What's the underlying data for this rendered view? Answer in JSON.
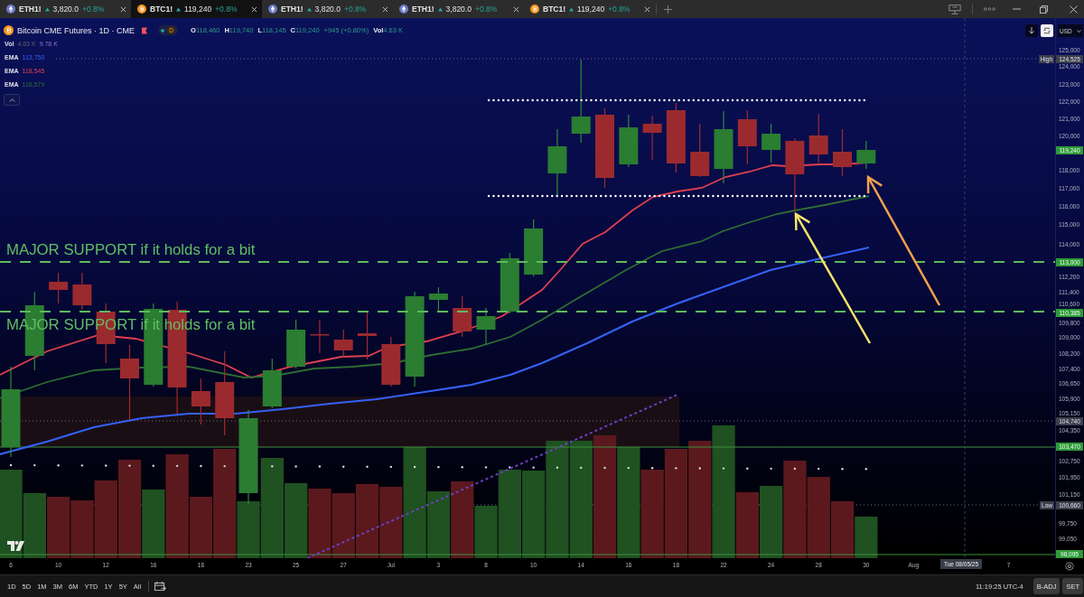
{
  "tabs": [
    {
      "kind": "ethereum",
      "symbol": "ETH1!",
      "price": "3,820.0",
      "change": "+0.8%",
      "selected": false
    },
    {
      "kind": "bitcoin",
      "symbol": "BTC1!",
      "price": "119,240",
      "change": "+0.8%",
      "selected": true
    },
    {
      "kind": "ethereum",
      "symbol": "ETH1!",
      "price": "3,820.0",
      "change": "+0.8%",
      "selected": false
    },
    {
      "kind": "ethereum",
      "symbol": "ETH1!",
      "price": "3,820.0",
      "change": "+0.8%",
      "selected": false
    },
    {
      "kind": "bitcoin",
      "symbol": "BTC1!",
      "price": "119,240",
      "change": "+0.8%",
      "selected": false
    }
  ],
  "legend": {
    "title": "Bitcoin CME Futures · 1D · CME",
    "delay": "D",
    "ohlc": [
      {
        "label": "O",
        "value": "118,460"
      },
      {
        "label": "H",
        "value": "119,740"
      },
      {
        "label": "L",
        "value": "118,145"
      },
      {
        "label": "C",
        "value": "119,240"
      }
    ],
    "change": "+945 (+0.80%)",
    "volume_label": "Vol",
    "volume": "4.63 K"
  },
  "indicators": [
    {
      "name": "Vol",
      "values": [
        "4.63 K",
        "9.78 K"
      ]
    },
    {
      "name": "EMA",
      "values": [
        "113,750"
      ],
      "color": "#3461f5"
    },
    {
      "name": "EMA",
      "values": [
        "118,545"
      ],
      "color": "#e0404f"
    },
    {
      "name": "EMA",
      "values": [
        "116,579"
      ],
      "color": "#2e6d33"
    }
  ],
  "annotations": [
    {
      "text": "MAJOR SUPPORT if it holds for a bit"
    },
    {
      "text": "MAJOR SUPPORT if it holds for a bit"
    }
  ],
  "currency": "USD",
  "price_axis": [
    {
      "text": "125,000",
      "kind": "tick"
    },
    {
      "text": "124,525",
      "kind": "marker",
      "label": "High"
    },
    {
      "text": "124,000",
      "kind": "tick"
    },
    {
      "text": "123,000",
      "kind": "tick"
    },
    {
      "text": "122,000",
      "kind": "tick"
    },
    {
      "text": "121,000",
      "kind": "tick"
    },
    {
      "text": "120,000",
      "kind": "tick"
    },
    {
      "text": "119,240",
      "kind": "price"
    },
    {
      "text": "118,000",
      "kind": "tick"
    },
    {
      "text": "117,000",
      "kind": "tick"
    },
    {
      "text": "116,000",
      "kind": "tick"
    },
    {
      "text": "115,000",
      "kind": "tick"
    },
    {
      "text": "114,000",
      "kind": "tick"
    },
    {
      "text": "113,000",
      "kind": "price"
    },
    {
      "text": "112,200",
      "kind": "tick"
    },
    {
      "text": "111,400",
      "kind": "tick"
    },
    {
      "text": "110,600",
      "kind": "tick"
    },
    {
      "text": "110,385",
      "kind": "price"
    },
    {
      "text": "109,800",
      "kind": "tick"
    },
    {
      "text": "109,000",
      "kind": "tick"
    },
    {
      "text": "108,200",
      "kind": "tick"
    },
    {
      "text": "107,400",
      "kind": "tick"
    },
    {
      "text": "106,650",
      "kind": "tick"
    },
    {
      "text": "105,900",
      "kind": "tick"
    },
    {
      "text": "105,150",
      "kind": "tick"
    },
    {
      "text": "104,740",
      "kind": "marker"
    },
    {
      "text": "104,350",
      "kind": "tick"
    },
    {
      "text": "103,470",
      "kind": "price"
    },
    {
      "text": "102,750",
      "kind": "tick"
    },
    {
      "text": "101,950",
      "kind": "tick"
    },
    {
      "text": "101,150",
      "kind": "tick"
    },
    {
      "text": "100,660",
      "kind": "marker",
      "label": "Low"
    },
    {
      "text": "99,750",
      "kind": "tick"
    },
    {
      "text": "99,050",
      "kind": "tick"
    },
    {
      "text": "98,095",
      "kind": "price"
    }
  ],
  "time_axis": [
    {
      "text": "6",
      "kind": "date"
    },
    {
      "text": "10",
      "kind": "date"
    },
    {
      "text": "12",
      "kind": "date"
    },
    {
      "text": "16",
      "kind": "date"
    },
    {
      "text": "18",
      "kind": "date"
    },
    {
      "text": "23",
      "kind": "date"
    },
    {
      "text": "25",
      "kind": "date"
    },
    {
      "text": "27",
      "kind": "date"
    },
    {
      "text": "Jul",
      "kind": "date"
    },
    {
      "text": "3",
      "kind": "date"
    },
    {
      "text": "8",
      "kind": "date"
    },
    {
      "text": "10",
      "kind": "date"
    },
    {
      "text": "14",
      "kind": "date"
    },
    {
      "text": "16",
      "kind": "date"
    },
    {
      "text": "18",
      "kind": "date"
    },
    {
      "text": "22",
      "kind": "date"
    },
    {
      "text": "24",
      "kind": "date"
    },
    {
      "text": "28",
      "kind": "date"
    },
    {
      "text": "30",
      "kind": "date"
    },
    {
      "text": "Aug",
      "kind": "date"
    },
    {
      "text": "Tue 08/05/25",
      "kind": "cursor"
    },
    {
      "text": "7",
      "kind": "date"
    }
  ],
  "bottom_bar": {
    "timeframes": [
      "1D",
      "5D",
      "1M",
      "3M",
      "6M",
      "YTD",
      "1Y",
      "5Y",
      "All"
    ],
    "clock": "11:19:25 UTC-4",
    "buttons": [
      "B-ADJ",
      "SET"
    ]
  }
}
